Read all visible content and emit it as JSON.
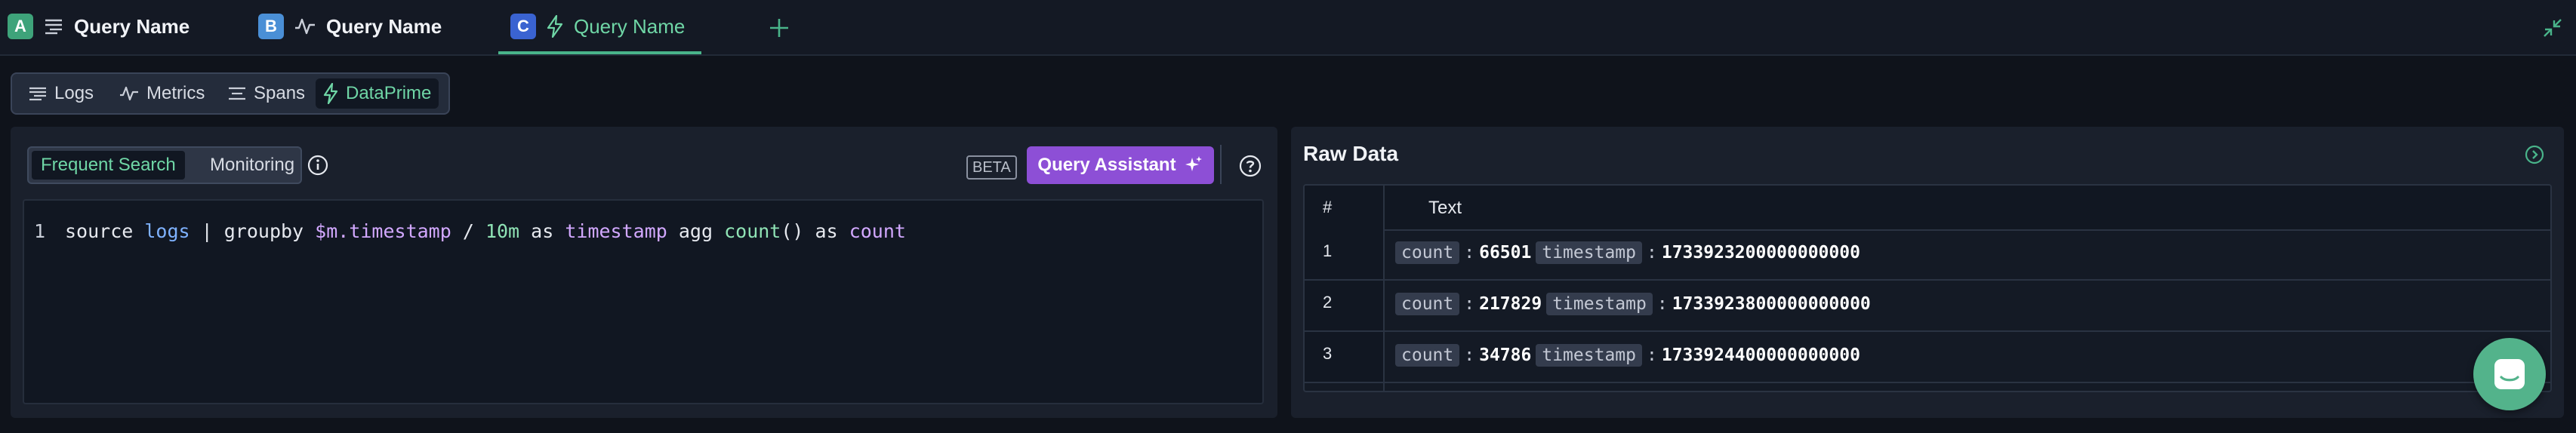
{
  "tabs": [
    {
      "badge": "A",
      "badge_color": "#3ea37a",
      "icon": "logs-icon",
      "label": "Query Name"
    },
    {
      "badge": "B",
      "badge_color": "#4a8fd6",
      "icon": "metrics-icon",
      "label": "Query Name"
    },
    {
      "badge": "C",
      "badge_color": "#3a63d1",
      "icon": "dataprime-icon",
      "label": "Query Name"
    }
  ],
  "data_types": [
    {
      "label": "Logs",
      "icon": "logs-icon"
    },
    {
      "label": "Metrics",
      "icon": "metrics-icon"
    },
    {
      "label": "Spans",
      "icon": "spans-icon"
    },
    {
      "label": "DataPrime",
      "icon": "dataprime-icon",
      "active": true
    }
  ],
  "editor": {
    "modes": [
      "Frequent Search",
      "Monitoring"
    ],
    "active_mode": "Frequent Search",
    "beta_label": "BETA",
    "assistant_label": "Query Assistant",
    "line_number": "1",
    "query_tokens": [
      "source",
      " ",
      "logs",
      " | ",
      "groupby",
      " ",
      "$m.timestamp",
      " / ",
      "10m",
      " ",
      "as",
      " ",
      "timestamp",
      " ",
      "agg",
      " ",
      "count",
      "()",
      " ",
      "as",
      " ",
      "count"
    ]
  },
  "raw_data": {
    "title": "Raw Data",
    "columns": [
      "#",
      "Text"
    ],
    "rows": [
      {
        "index": "1",
        "k1": "count",
        "v1": "66501",
        "k2": "timestamp",
        "v2": "1733923200000000000"
      },
      {
        "index": "2",
        "k1": "count",
        "v1": "217829",
        "k2": "timestamp",
        "v2": "1733923800000000000"
      },
      {
        "index": "3",
        "k1": "count",
        "v1": "34786",
        "k2": "timestamp",
        "v2": "1733924400000000000"
      }
    ]
  },
  "colors": {
    "accent_green": "#6fd6a6",
    "assistant_purple": "#8d4fd6",
    "background": "#0f131b"
  }
}
